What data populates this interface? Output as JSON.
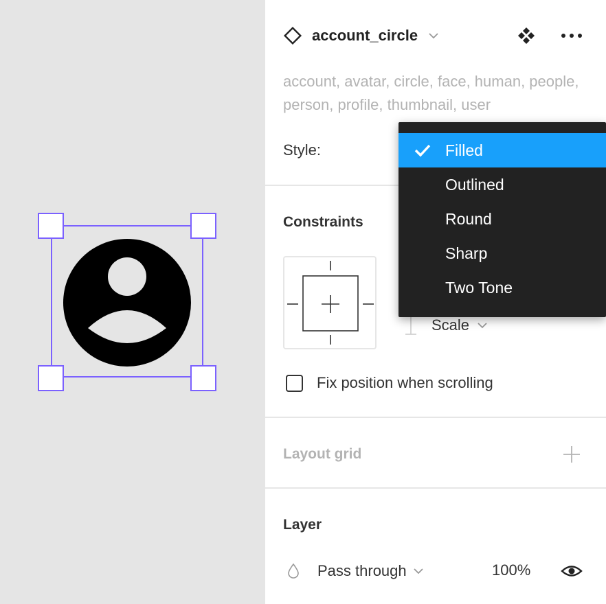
{
  "component": {
    "name": "account_circle",
    "keywords": "account, avatar, circle, face, human, people, person, profile, thumbnail, user"
  },
  "properties": {
    "style_label": "Style:",
    "style_options": [
      "Filled",
      "Outlined",
      "Round",
      "Sharp",
      "Two Tone"
    ],
    "selected_style": "Filled"
  },
  "constraints": {
    "title": "Constraints",
    "vertical": "Scale",
    "fix_position_label": "Fix position when scrolling",
    "fix_position_checked": false
  },
  "layout_grid": {
    "title": "Layout grid"
  },
  "layer": {
    "title": "Layer",
    "blend_mode": "Pass through",
    "opacity": "100%"
  },
  "colors": {
    "selection": "#7b61ff",
    "dropdown_bg": "#222222",
    "dropdown_selected": "#18a0fb",
    "canvas_bg": "#e5e5e5"
  },
  "icons": {
    "component": "component-diamond-icon",
    "instance_menu": "component-variants-icon",
    "more": "more-dots-icon",
    "add": "plus-icon",
    "blend": "drop-icon",
    "visibility": "eye-icon",
    "check": "check-icon"
  }
}
